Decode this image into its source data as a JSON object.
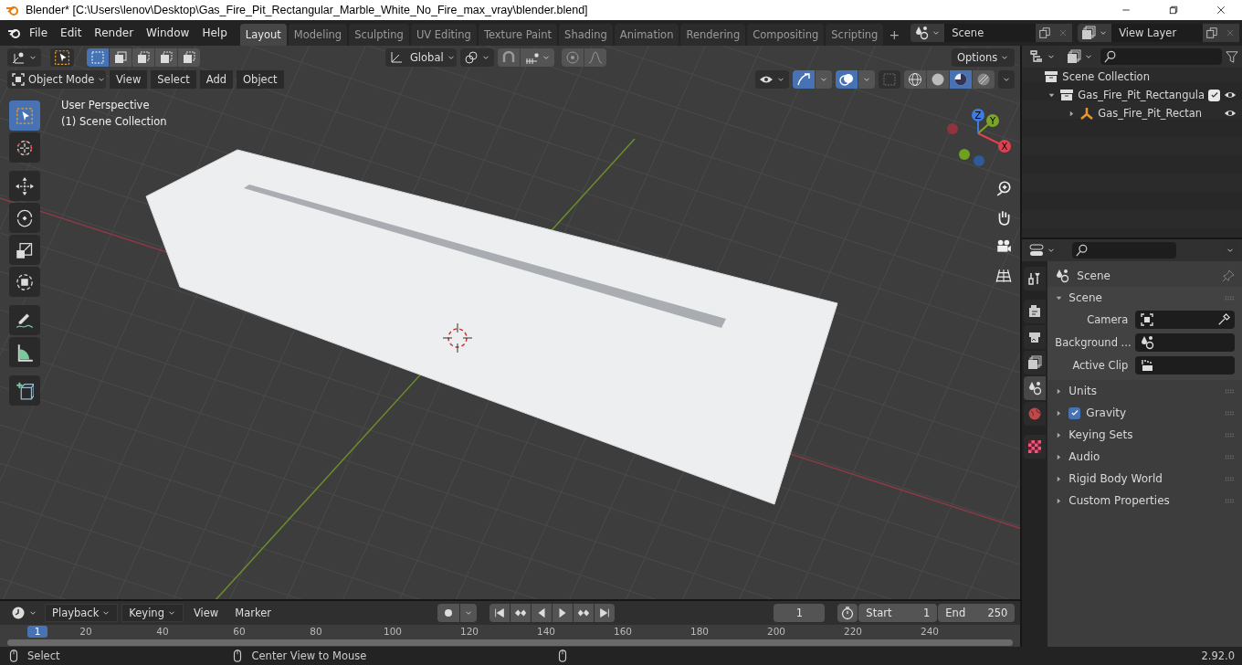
{
  "window": {
    "title": "Blender* [C:\\Users\\lenov\\Desktop\\Gas_Fire_Pit_Rectangular_Marble_White_No_Fire_max_vray\\blender.blend]"
  },
  "menu": [
    "File",
    "Edit",
    "Render",
    "Window",
    "Help"
  ],
  "workspaces": [
    {
      "label": "Layout",
      "selected": true
    },
    {
      "label": "Modeling",
      "selected": false
    },
    {
      "label": "Sculpting",
      "selected": false
    },
    {
      "label": "UV Editing",
      "selected": false
    },
    {
      "label": "Texture Paint",
      "selected": false
    },
    {
      "label": "Shading",
      "selected": false
    },
    {
      "label": "Animation",
      "selected": false
    },
    {
      "label": "Rendering",
      "selected": false
    },
    {
      "label": "Compositing",
      "selected": false
    },
    {
      "label": "Scripting",
      "selected": false
    }
  ],
  "add_workspace": "+",
  "scene_field": {
    "value": "Scene"
  },
  "view_layer_field": {
    "value": "View Layer"
  },
  "tool_header": {
    "orientation": "Global",
    "options": "Options"
  },
  "viewport_header": {
    "mode": "Object Mode",
    "menus": [
      "View",
      "Select",
      "Add",
      "Object"
    ]
  },
  "shading_modes": [
    {
      "kind": "wireframe",
      "selected": false
    },
    {
      "kind": "solid",
      "selected": false
    },
    {
      "kind": "material",
      "selected": true
    },
    {
      "kind": "rendered",
      "selected": false
    }
  ],
  "viewport": {
    "overlay_text": [
      "User Perspective",
      "(1) Scene Collection"
    ],
    "tools": [
      {
        "kind": "select",
        "selected": true
      },
      {
        "kind": "cursor",
        "selected": false
      },
      {
        "kind": "move",
        "selected": false
      },
      {
        "kind": "rotate",
        "selected": false
      },
      {
        "kind": "scale",
        "selected": false
      },
      {
        "kind": "transform",
        "selected": false
      },
      {
        "kind": "annotate",
        "selected": false
      },
      {
        "kind": "measure",
        "selected": false
      },
      {
        "kind": "add_cube",
        "selected": false
      }
    ],
    "gizmo_axes": [
      "X",
      "Y",
      "Z"
    ]
  },
  "outliner": {
    "root": "Scene Collection",
    "items": [
      {
        "label": "Gas_Fire_Pit_Rectangula",
        "kind": "collection",
        "expanded": true,
        "checked": true,
        "children": [
          {
            "label": "Gas_Fire_Pit_Rectan",
            "kind": "empty",
            "expanded": false
          }
        ]
      }
    ]
  },
  "properties": {
    "tabs": [
      {
        "kind": "tool",
        "selected": false
      },
      {
        "kind": "render",
        "selected": false
      },
      {
        "kind": "output",
        "selected": false
      },
      {
        "kind": "view_layer",
        "selected": false
      },
      {
        "kind": "scene",
        "selected": true
      },
      {
        "kind": "world",
        "selected": false
      },
      {
        "kind": "texture",
        "selected": false
      }
    ],
    "context": "Scene",
    "panel": {
      "title": "Scene",
      "expanded": true,
      "fields": [
        {
          "label": "Camera",
          "kind": "camera"
        },
        {
          "label": "Background ...",
          "kind": "scene"
        },
        {
          "label": "Active Clip",
          "kind": "clip"
        }
      ]
    },
    "subpanels": [
      {
        "label": "Units",
        "expanded": false
      },
      {
        "label": "Gravity",
        "expanded": false,
        "checked": true
      },
      {
        "label": "Keying Sets",
        "expanded": false
      },
      {
        "label": "Audio",
        "expanded": false
      },
      {
        "label": "Rigid Body World",
        "expanded": false
      },
      {
        "label": "Custom Properties",
        "expanded": false
      }
    ]
  },
  "timeline": {
    "menus": [
      "Playback",
      "Keying",
      "View",
      "Marker"
    ],
    "current_frame": "1",
    "start": {
      "label": "Start",
      "value": "1"
    },
    "end": {
      "label": "End",
      "value": "250"
    },
    "playhead": "1",
    "ruler": [
      "20",
      "40",
      "60",
      "80",
      "100",
      "120",
      "140",
      "160",
      "180",
      "200",
      "220",
      "240"
    ]
  },
  "status_bar": {
    "hints": [
      "Select",
      "Center View to Mouse"
    ],
    "version": "2.92.0"
  }
}
